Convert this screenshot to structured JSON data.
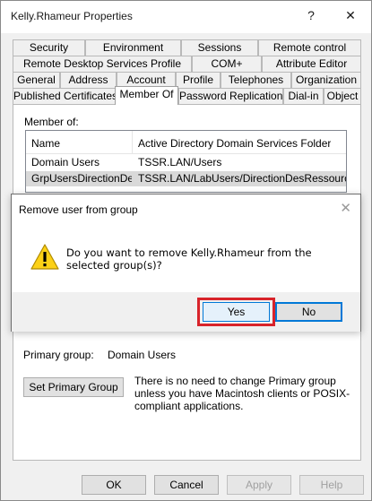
{
  "window": {
    "title": "Kelly.Rhameur Properties",
    "help_glyph": "?",
    "close_glyph": "✕"
  },
  "tabs": {
    "row1": [
      "Security",
      "Environment",
      "Sessions",
      "Remote control"
    ],
    "row2": [
      "Remote Desktop Services Profile",
      "COM+",
      "Attribute Editor"
    ],
    "row3": [
      "General",
      "Address",
      "Account",
      "Profile",
      "Telephones",
      "Organization"
    ],
    "row4": [
      "Published Certificates",
      "Member Of",
      "Password Replication",
      "Dial-in",
      "Object"
    ],
    "active": "Member Of"
  },
  "member_of": {
    "label": "Member of:",
    "columns": [
      "Name",
      "Active Directory Domain Services Folder"
    ],
    "rows": [
      [
        "Domain Users",
        "TSSR.LAN/Users"
      ],
      [
        "GrpUsersDirectionDe...",
        "TSSR.LAN/LabUsers/DirectionDesRessources."
      ]
    ]
  },
  "primary_group": {
    "label": "Primary group:",
    "value": "Domain Users",
    "set_button": "Set Primary Group",
    "note": "There is no need to change Primary group unless you have Macintosh clients or POSIX-compliant applications."
  },
  "footer": {
    "ok": "OK",
    "cancel": "Cancel",
    "apply": "Apply",
    "help": "Help"
  },
  "dialog": {
    "title": "Remove user from group",
    "close_glyph": "✕",
    "message": "Do you want to remove Kelly.Rhameur from the selected group(s)?",
    "yes": "Yes",
    "no": "No",
    "icon": "warning-icon",
    "highlight_color": "#d8232a"
  }
}
